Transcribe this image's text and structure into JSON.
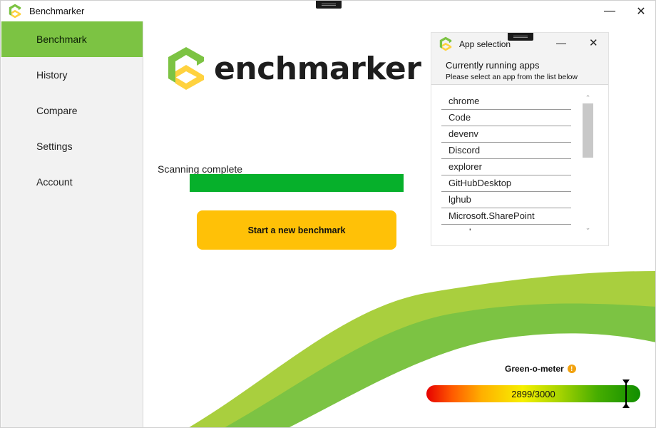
{
  "window": {
    "title": "Benchmarker"
  },
  "sidebar": {
    "items": [
      {
        "label": "Benchmark",
        "active": true
      },
      {
        "label": "History",
        "active": false
      },
      {
        "label": "Compare",
        "active": false
      },
      {
        "label": "Settings",
        "active": false
      },
      {
        "label": "Account",
        "active": false
      }
    ]
  },
  "main": {
    "brand_text": "enchmarker",
    "scan_status": "Scanning complete",
    "scan_progress": 1.0,
    "start_button": "Start a new benchmark"
  },
  "popup": {
    "title": "App selection",
    "heading": "Currently running apps",
    "subheading": "Please select an app from the list below",
    "apps": [
      "chrome",
      "Code",
      "devenv",
      "Discord",
      "explorer",
      "GitHubDesktop",
      "lghub",
      "Microsoft.SharePoint",
      "msedge"
    ]
  },
  "meter": {
    "label": "Green-o-meter",
    "value_text": "2899/3000",
    "value": 2899,
    "max": 3000
  },
  "colors": {
    "accent_green": "#7cc343",
    "progress_green": "#06b02b",
    "button_yellow": "#ffc107",
    "logo_green": "#7cc343",
    "logo_yellow": "#ffd23f"
  },
  "icons": {
    "app_logo": "benchmarker-logo-icon",
    "minimize": "minimize-icon",
    "close": "close-icon",
    "info": "info-icon"
  }
}
